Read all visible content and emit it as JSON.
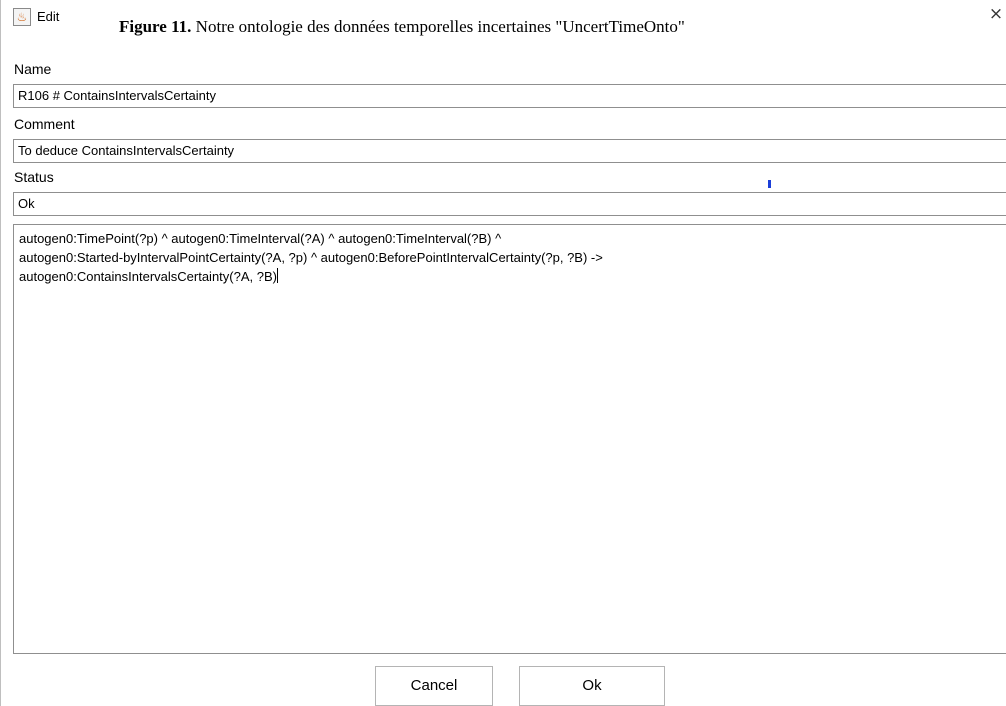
{
  "window": {
    "title": "Edit",
    "close_glyph": "×",
    "app_icon": "java-cup-icon"
  },
  "caption": {
    "figure_label": "Figure 11.",
    "text": " Notre ontologie des données temporelles incertaines \"UncertTimeOnto\""
  },
  "form": {
    "name_label": "Name",
    "name_value": "R106 # ContainsIntervalsCertainty",
    "comment_label": "Comment",
    "comment_value": "To deduce ContainsIntervalsCertainty",
    "status_label": "Status",
    "status_value": "Ok",
    "rule_lines": [
      "autogen0:TimePoint(?p) ^ autogen0:TimeInterval(?A) ^ autogen0:TimeInterval(?B) ^",
      "autogen0:Started-byIntervalPointCertainty(?A, ?p) ^ autogen0:BeforePointIntervalCertainty(?p, ?B) ->",
      "autogen0:ContainsIntervalsCertainty(?A, ?B)"
    ]
  },
  "buttons": {
    "cancel_label": "Cancel",
    "ok_label": "Ok"
  },
  "colors": {
    "border": "#8f8f8f",
    "marker": "#1c3fd8"
  }
}
